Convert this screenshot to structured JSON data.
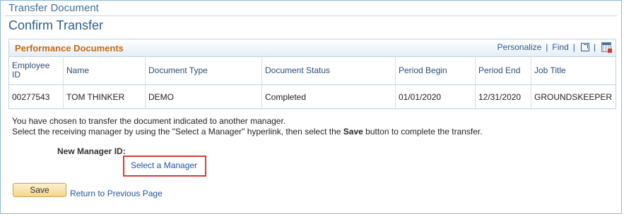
{
  "breadcrumb": "Transfer Document",
  "page_title": "Confirm Transfer",
  "grid": {
    "title": "Performance Documents",
    "tools": {
      "personalize": "Personalize",
      "find": "Find"
    },
    "columns": [
      "Employee ID",
      "Name",
      "Document Type",
      "Document Status",
      "Period Begin",
      "Period End",
      "Job Title"
    ],
    "rows": [
      [
        "00277543",
        "TOM THINKER",
        "DEMO",
        "Completed",
        "01/01/2020",
        "12/31/2020",
        "GROUNDSKEEPER"
      ]
    ]
  },
  "instructions": {
    "line1": "You have chosen to transfer the document indicated to another manager.",
    "line2_pre": "Select the receiving manager by using the \"Select a Manager\" hyperlink, then select the ",
    "line2_bold": "Save",
    "line2_post": " button to complete the transfer."
  },
  "new_manager_label": "New Manager ID:",
  "select_manager_link": "Select a Manager",
  "save_button": "Save",
  "return_link": "Return to Previous Page",
  "colors": {
    "accent_orange": "#c66a14",
    "link_blue": "#1f56a0",
    "highlight_red": "#d63a3a"
  },
  "icons": [
    "zoom-icon",
    "download-icon"
  ]
}
